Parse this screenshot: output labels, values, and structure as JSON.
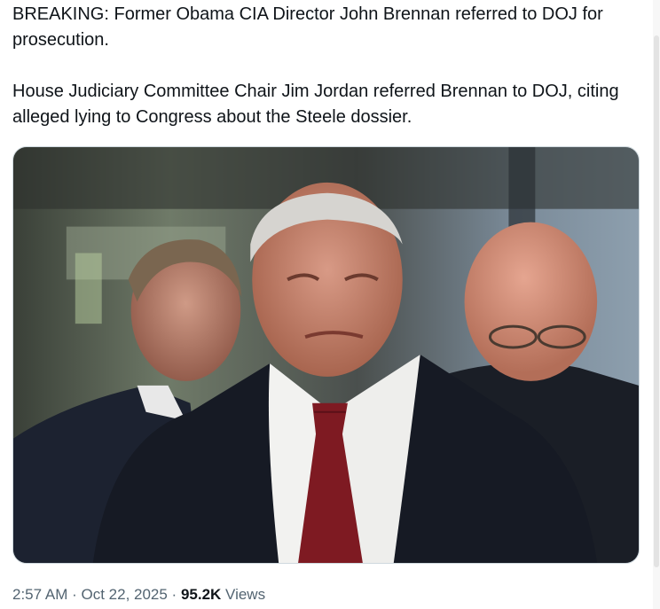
{
  "tweet": {
    "paragraph1": "BREAKING: Former Obama CIA Director John Brennan referred to DOJ for prosecution.",
    "paragraph2": "House Judiciary Committee Chair Jim Jordan referred Brennan to DOJ, citing alleged lying to Congress about the Steele dossier."
  },
  "meta": {
    "time": "2:57 AM",
    "sep1": " · ",
    "date": "Oct 22, 2025",
    "sep2": " · ",
    "views_count": "95.2K",
    "views_label": " Views"
  },
  "media": {
    "description_icon": "photo"
  },
  "colors": {
    "text": "#0f1419",
    "secondary": "#536471",
    "border": "#cfd9de"
  }
}
